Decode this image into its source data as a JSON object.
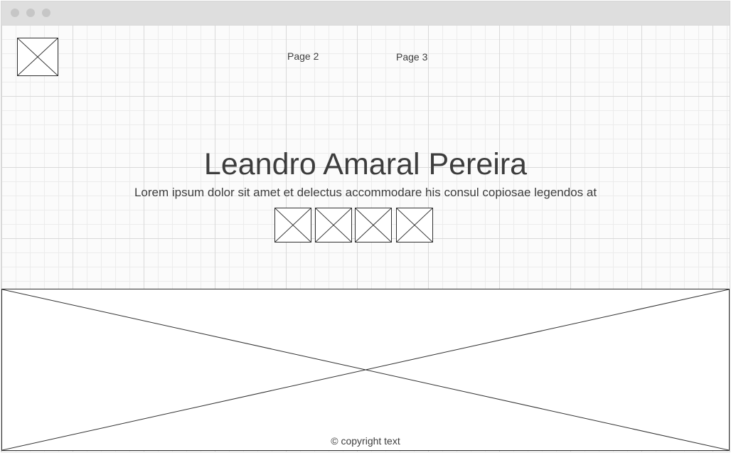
{
  "window": {
    "controls": [
      "close-dot",
      "minimize-dot",
      "maximize-dot"
    ]
  },
  "nav": {
    "logo_icon": "image-placeholder-icon",
    "links": [
      {
        "label": "Page 2"
      },
      {
        "label": "Page 3"
      }
    ]
  },
  "hero": {
    "title": "Leandro Amaral Pereira",
    "subtitle": "Lorem ipsum dolor sit amet et delectus accommodare his consul copiosae legendos at",
    "social_icons": [
      "image-placeholder-icon",
      "image-placeholder-icon",
      "image-placeholder-icon",
      "image-placeholder-icon"
    ]
  },
  "banner": {
    "icon": "image-placeholder-icon"
  },
  "footer": {
    "copyright": "© copyright text"
  }
}
